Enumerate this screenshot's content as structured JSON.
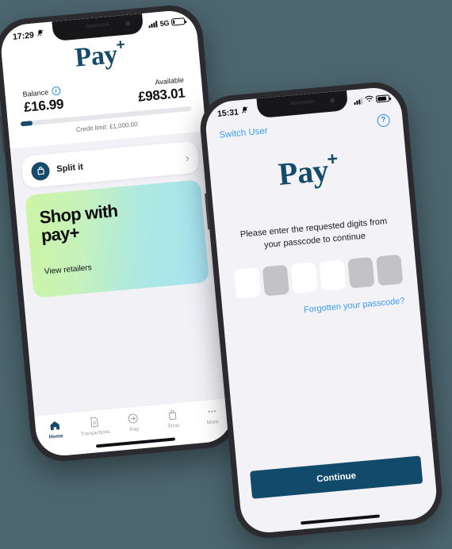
{
  "scene": {
    "background_color": "#4c666f",
    "brand_navy": "#154a6b",
    "link_blue": "#3b9bf5"
  },
  "phone_home": {
    "status": {
      "time": "17:29",
      "mute_icon": "bell-slash-icon",
      "network": "5G",
      "signal_icon": "signal-bars-icon",
      "battery_icon": "battery-low-icon",
      "battery_level_pct": 14
    },
    "logo": {
      "text": "Pay",
      "plus": "+"
    },
    "balance": {
      "caption": "Balance",
      "info_icon": "info-icon",
      "amount": "£16.99",
      "available_caption": "Available",
      "available_amount": "£983.01",
      "progress_pct": 2,
      "credit_limit_text": "Credit limit: £1,000.00"
    },
    "split_card": {
      "icon": "shopping-bag-icon",
      "label": "Split it",
      "chevron": "›"
    },
    "promo": {
      "title_line1": "Shop with",
      "title_line2": "pay+",
      "link": "View retailers",
      "gradient_from": "#cdf5a4",
      "gradient_to": "#a6e2f2"
    },
    "tabs": [
      {
        "label": "Home",
        "icon": "home-icon",
        "active": true
      },
      {
        "label": "Transactions",
        "icon": "document-icon",
        "active": false
      },
      {
        "label": "Pay",
        "icon": "arrow-circle-icon",
        "active": false
      },
      {
        "label": "Shop",
        "icon": "bag-icon",
        "active": false
      },
      {
        "label": "More",
        "icon": "ellipsis-icon",
        "active": false
      }
    ]
  },
  "phone_passcode": {
    "status": {
      "time": "15:31",
      "mute_icon": "bell-slash-icon",
      "signal_icon": "signal-bars-icon",
      "wifi_icon": "wifi-icon",
      "battery_icon": "battery-icon",
      "battery_level_pct": 72
    },
    "topbar": {
      "switch_user": "Switch User",
      "help_icon": "question-mark-circle-icon",
      "help_label": "?"
    },
    "logo": {
      "text": "Pay",
      "plus": "+"
    },
    "instruction": "Please enter the requested digits from your passcode to continue",
    "digits": [
      {
        "enabled": true
      },
      {
        "enabled": false
      },
      {
        "enabled": true
      },
      {
        "enabled": true
      },
      {
        "enabled": false
      },
      {
        "enabled": false
      }
    ],
    "forgot_link": "Forgotten your passcode?",
    "continue_label": "Continue"
  }
}
